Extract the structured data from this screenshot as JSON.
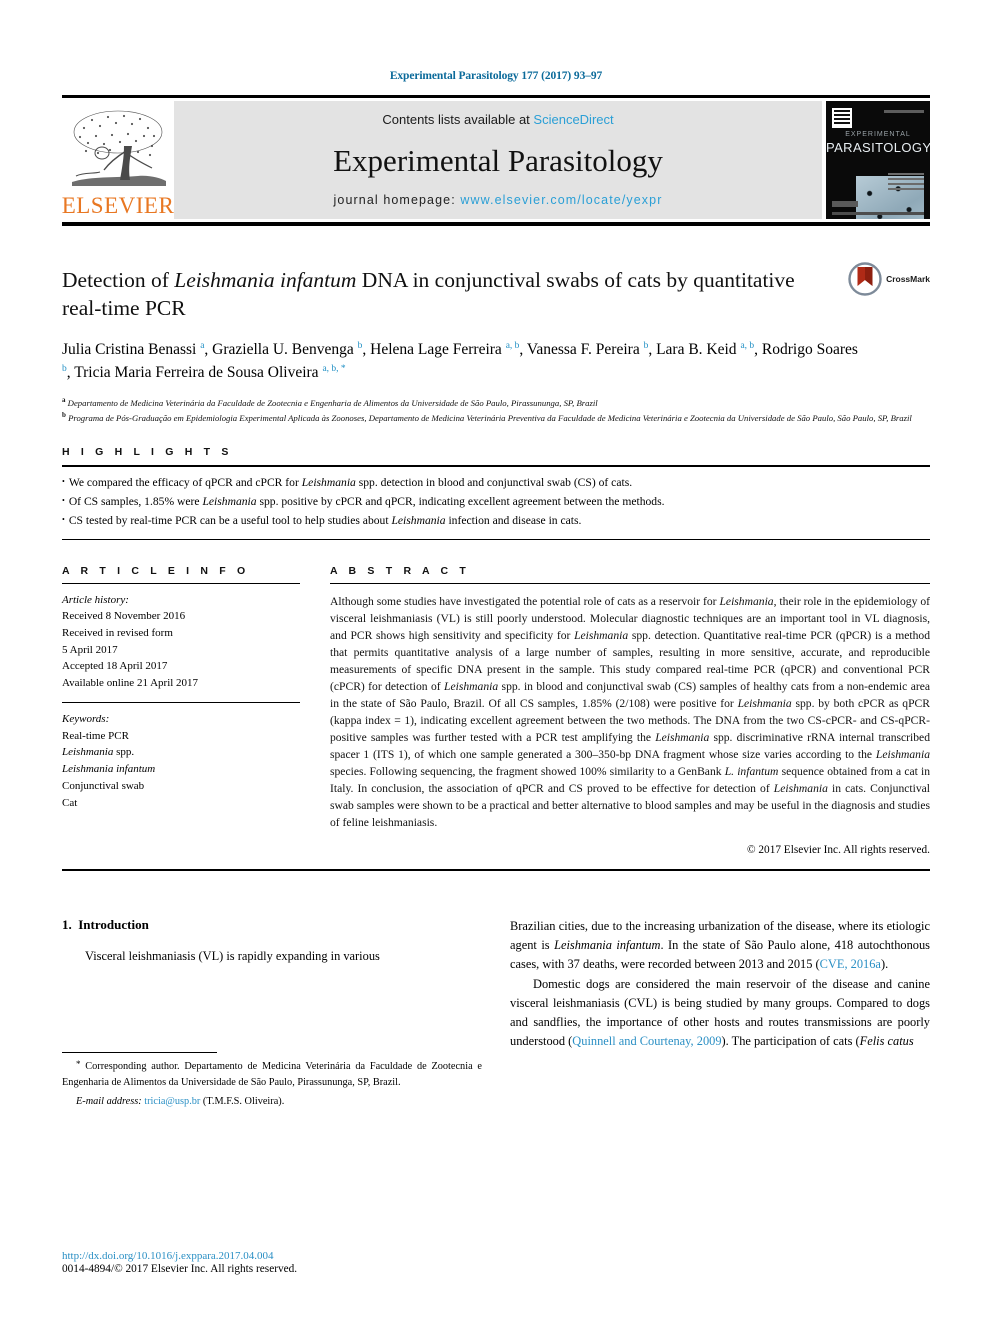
{
  "running_head": "Experimental Parasitology 177 (2017) 93–97",
  "masthead": {
    "contents_prefix": "Contents lists available at",
    "sciencedirect": "ScienceDirect",
    "journal_title": "Experimental Parasitology",
    "homepage_prefix": "journal homepage:",
    "homepage_url": "www.elsevier.com/locate/yexpr",
    "publisher": "ELSEVIER",
    "cover_line1": "EXPERIMENTAL",
    "cover_line2": "PARASITOLOGY",
    "link_color": "#2a9fd6",
    "band_color": "#e3e3e3",
    "publisher_color": "#e87722"
  },
  "article": {
    "title_part1": "Detection of ",
    "title_italic": "Leishmania infantum",
    "title_part2": " DNA in conjunctival swabs of cats by quantitative real-time PCR",
    "crossmark_label": "CrossMark",
    "authors_html": "Julia Cristina Benassi <sup>a</sup>, Graziella U. Benvenga <sup>b</sup>, Helena Lage Ferreira <sup>a, b</sup>, Vanessa F. Pereira <sup>b</sup>, Lara B. Keid <sup>a, b</sup>, Rodrigo Soares <sup>b</sup>, Tricia Maria Ferreira de Sousa Oliveira <sup>a, b, *</sup>",
    "affiliation_a": "Departamento de Medicina Veterinária da Faculdade de Zootecnia e Engenharia de Alimentos da Universidade de São Paulo, Pirassununga, SP, Brazil",
    "affiliation_b": "Programa de Pós-Graduação em Epidemiologia Experimental Aplicada às Zoonoses, Departamento de Medicina Veterinária Preventiva da Faculdade de Medicina Veterinária e Zootecnia da Universidade de São Paulo, São Paulo, SP, Brazil"
  },
  "highlights": {
    "heading": "H I G H L I G H T S",
    "items_html": [
      "We compared the efficacy of qPCR and cPCR for <i>Leishmania</i> spp. detection in blood and conjunctival swab (CS) of cats.",
      "Of CS samples, 1.85% were <i>Leishmania</i> spp. positive by cPCR and qPCR, indicating excellent agreement between the methods.",
      "CS tested by real-time PCR can be a useful tool to help studies about <i>Leishmania</i> infection and disease in cats."
    ]
  },
  "article_info": {
    "heading": "A R T I C L E   I N F O",
    "history_label": "Article history:",
    "history_lines": [
      "Received 8 November 2016",
      "Received in revised form",
      "5 April 2017",
      "Accepted 18 April 2017",
      "Available online 21 April 2017"
    ],
    "keywords_label": "Keywords:",
    "keywords_html": [
      "Real-time PCR",
      "<i>Leishmania</i> spp.",
      "<i>Leishmania infantum</i>",
      "Conjunctival swab",
      "Cat"
    ]
  },
  "abstract": {
    "heading": "A B S T R A C T",
    "text_html": "Although some studies have investigated the potential role of cats as a reservoir for <i>Leishmania</i>, their role in the epidemiology of visceral leishmaniasis (VL) is still poorly understood. Molecular diagnostic techniques are an important tool in VL diagnosis, and PCR shows high sensitivity and specificity for <i>Leishmania</i> spp. detection. Quantitative real-time PCR (qPCR) is a method that permits quantitative analysis of a large number of samples, resulting in more sensitive, accurate, and reproducible measurements of specific DNA present in the sample. This study compared real-time PCR (qPCR) and conventional PCR (cPCR) for detection of <i>Leishmania</i> spp. in blood and conjunctival swab (CS) samples of healthy cats from a non-endemic area in the state of São Paulo, Brazil. Of all CS samples, 1.85% (2/108) were positive for <i>Leishmania</i> spp. by both cPCR as qPCR (kappa index = 1), indicating excellent agreement between the two methods. The DNA from the two CS-cPCR- and CS-qPCR-positive samples was further tested with a PCR test amplifying the <i>Leishmania</i> spp. discriminative rRNA internal transcribed spacer 1 (ITS 1), of which one sample generated a 300–350-bp DNA fragment whose size varies according to the <i>Leishmania</i> species. Following sequencing, the fragment showed 100% similarity to a GenBank <i>L. infantum</i> sequence obtained from a cat in Italy. In conclusion, the association of qPCR and CS proved to be effective for detection of <i>Leishmania</i> in cats. Conjunctival swab samples were shown to be a practical and better alternative to blood samples and may be useful in the diagnosis and studies of feline leishmaniasis.",
    "copyright": "© 2017 Elsevier Inc. All rights reserved."
  },
  "body": {
    "section_number": "1.",
    "section_title": "Introduction",
    "left_para_html": "Visceral leishmaniasis (VL) is rapidly expanding in various",
    "right_para1_html": "Brazilian cities, due to the increasing urbanization of the disease, where its etiologic agent is <i>Leishmania infantum</i>. In the state of São Paulo alone, 418 autochthonous cases, with 37 deaths, were recorded between 2013 and 2015 (<span class=\"lnk\">CVE, 2016a</span>).",
    "right_para2_html": "Domestic dogs are considered the main reservoir of the disease and canine visceral leishmaniasis (CVL) is being studied by many groups. Compared to dogs and sandflies, the importance of other hosts and routes transmissions are poorly understood (<span class=\"lnk\">Quinnell and Courtenay, 2009</span>). The participation of cats (<i>Felis catus</i>"
  },
  "footnote": {
    "corresponding_html": "<span class=\"star\">*</span> Corresponding author. Departamento de Medicina Veterinária da Faculdade de Zootecnia e Engenharia de Alimentos da Universidade de São Paulo, Pirassununga, SP, Brazil.",
    "email_html": "<i>E-mail address:</i> <span class=\"lnk\">tricia@usp.br</span> (T.M.F.S. Oliveira)."
  },
  "page_footer": {
    "doi": "http://dx.doi.org/10.1016/j.exppara.2017.04.004",
    "issn_copyright": "0014-4894/© 2017 Elsevier Inc. All rights reserved."
  }
}
